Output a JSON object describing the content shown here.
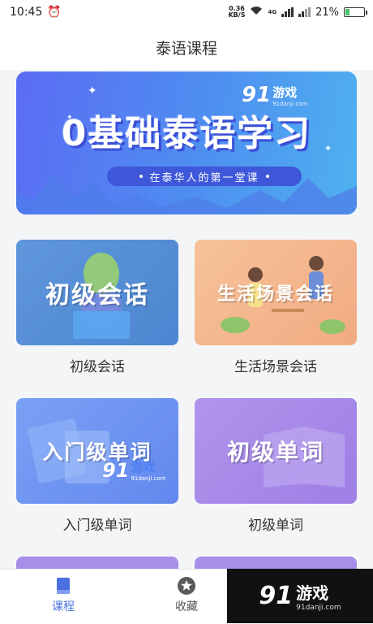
{
  "status_bar": {
    "time": "10:45",
    "net_speed_value": "0.36",
    "net_speed_unit": "KB/S",
    "network_type": "4G",
    "battery": "21%"
  },
  "header": {
    "title": "泰语课程"
  },
  "banner": {
    "title": "0基础泰语学习",
    "subtitle": "在泰华人的第一堂课"
  },
  "watermark": {
    "number": "91",
    "text": "游戏",
    "url": "91danji.com"
  },
  "courses": [
    {
      "card_text": "初级会话",
      "label": "初级会话",
      "color": "#5b8fd6"
    },
    {
      "card_text": "生活场景会话",
      "label": "生活场景会话",
      "color": "#f4b98c"
    },
    {
      "card_text": "入门级单词",
      "label": "入门级单词",
      "color": "#6f94f2"
    },
    {
      "card_text": "初级单词",
      "label": "初级单词",
      "color": "#a98ae8"
    }
  ],
  "bottom_nav": [
    {
      "label": "课程",
      "active": true,
      "icon": "book-icon",
      "color": "#4a6fe0"
    },
    {
      "label": "收藏",
      "active": false,
      "icon": "star-icon",
      "color": "#666666"
    }
  ]
}
